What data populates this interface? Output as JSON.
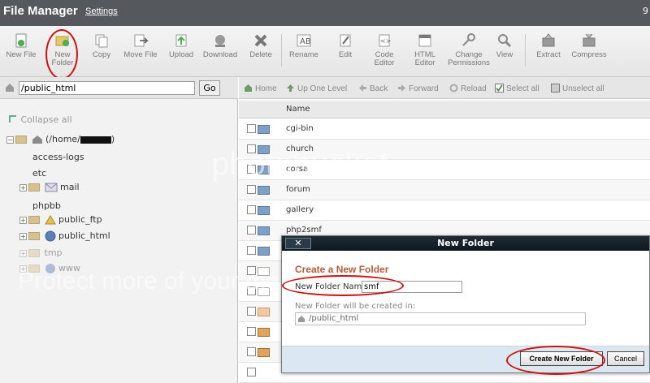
{
  "header": {
    "app_title": "File Manager",
    "settings_link": "Settings",
    "corner_text": "9"
  },
  "toolbar": {
    "new_file": "New File",
    "new_folder": "New Folder",
    "copy": "Copy",
    "move_file": "Move File",
    "upload": "Upload",
    "download": "Download",
    "delete": "Delete",
    "rename": "Rename",
    "edit": "Edit",
    "code_editor": "Code Editor",
    "html_editor": "HTML Editor",
    "change_permissions": "Change Permissions",
    "view": "View",
    "extract": "Extract",
    "compress": "Compress"
  },
  "pathbar": {
    "path_value": "/public_html",
    "go_label": "Go"
  },
  "tree": {
    "collapse_all": "Collapse all",
    "root": "(/home/",
    "items": [
      "access-logs",
      "etc",
      "mail",
      "phpbb",
      "public_ftp",
      "public_html",
      "tmp",
      "www"
    ]
  },
  "nav": {
    "home": "Home",
    "up_one_level": "Up One Level",
    "back": "Back",
    "forward": "Forward",
    "reload": "Reload",
    "select_all": "Select all",
    "unselect_all": "Unselect all"
  },
  "files": {
    "column_name": "Name",
    "rows": [
      "cgi-bin",
      "church",
      "corsa",
      "forum",
      "gallery",
      "php2smf"
    ]
  },
  "watermark": {
    "text": "photobucket",
    "subtext": "Protect more of your memories for less!"
  },
  "dialog": {
    "title": "New Folder",
    "close": "✕",
    "heading": "Create a New Folder",
    "name_label": "New Folder Name:",
    "name_value": "smf",
    "created_in_label": "New Folder will be created in:",
    "created_in_path": "/public_html",
    "create_button": "Create New Folder",
    "cancel_button": "Cancel"
  },
  "colors": {
    "titlebar": "#55585c",
    "highlight_circle": "#cc1111",
    "dialog_header": "#0d1820",
    "dialog_heading": "#b85c3a"
  }
}
